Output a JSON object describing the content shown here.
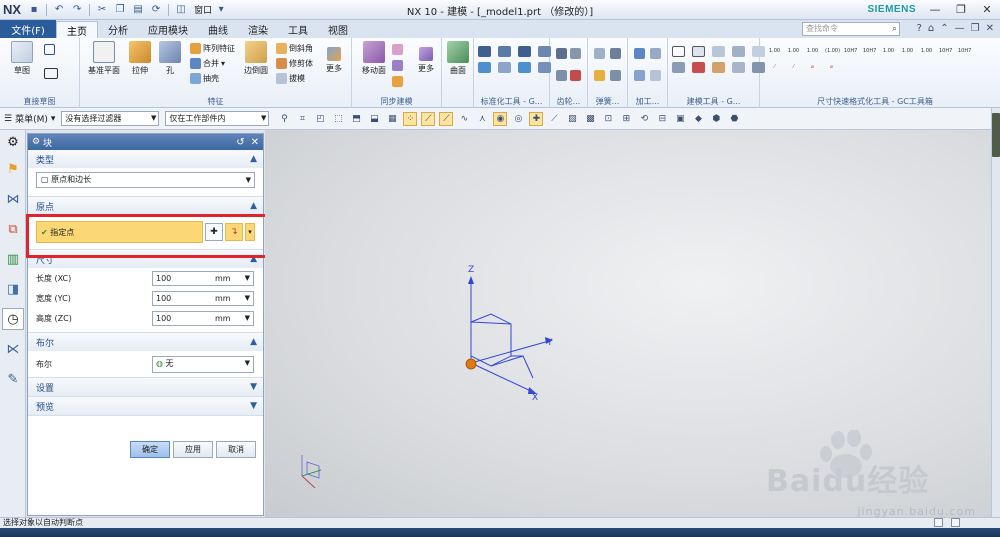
{
  "title_bar": {
    "logo": "NX",
    "window_menu": "窗口",
    "title": "NX 10 - 建模 - [_model1.prt （修改的）]",
    "brand": "SIEMENS"
  },
  "tabs": {
    "file": "文件(F)",
    "items": [
      "主页",
      "分析",
      "应用模块",
      "曲线",
      "渲染",
      "工具",
      "视图"
    ],
    "active": "主页",
    "search_placeholder": "查找命令"
  },
  "ribbon": {
    "sketch": {
      "btn": "草图",
      "label": "直接草图"
    },
    "feature": {
      "datum": "基准平面",
      "extrude": "拉伸",
      "hole": "孔",
      "pattern": "阵列特征",
      "unite": "合并",
      "shell": "抽壳",
      "edge_blend": "边倒圆",
      "chamfer": "倒斜角",
      "trim_body": "修剪体",
      "draft": "拔模",
      "more": "更多",
      "label": "特征"
    },
    "sync": {
      "move_face": "移动面",
      "more": "更多",
      "label": "同步建模"
    },
    "surface": {
      "btn": "曲面"
    },
    "group_labels": {
      "std": "标准化工具 - G...",
      "gear": "齿轮...",
      "spring": "弹簧...",
      "machining": "加工...",
      "modeling": "建模工具 - G...",
      "dim": "尺寸快速格式化工具 - GC工具箱"
    },
    "dim_codes": [
      "1.00",
      "1.00",
      "1.00",
      "(1.00)",
      "10H7",
      "10H7",
      "1.00",
      "1.00",
      "1.00",
      "10H7",
      "10H7"
    ]
  },
  "selection_bar": {
    "menu": "菜单(M)",
    "filter": "没有选择过滤器",
    "scope": "仅在工作部件内"
  },
  "dialog": {
    "title": "块",
    "type": {
      "header": "类型",
      "value": "原点和边长"
    },
    "origin": {
      "header": "原点",
      "specify": "指定点"
    },
    "size": {
      "header": "尺寸",
      "length_label": "长度 (XC)",
      "length": "100",
      "width_label": "宽度 (YC)",
      "width": "100",
      "height_label": "高度 (ZC)",
      "height": "100",
      "unit": "mm"
    },
    "boolean": {
      "header": "布尔",
      "label": "布尔",
      "value": "无"
    },
    "settings": "设置",
    "preview": "预览",
    "ok": "确定",
    "apply": "应用",
    "cancel": "取消"
  },
  "viewport": {
    "axis_z": "Z",
    "axis_y": "Y",
    "axis_x": "X",
    "watermark": "jingyan.baidu.com",
    "watermark_logo": "Baidu经验"
  },
  "status": "选择对象以自动判断点",
  "colors": {
    "file_tab": "#2a5b9b",
    "highlight": "#e3232a",
    "specify_fill": "#fbd775",
    "axis": "#3346d6",
    "origin": "#e07a10",
    "brand": "#1e9aa0"
  }
}
